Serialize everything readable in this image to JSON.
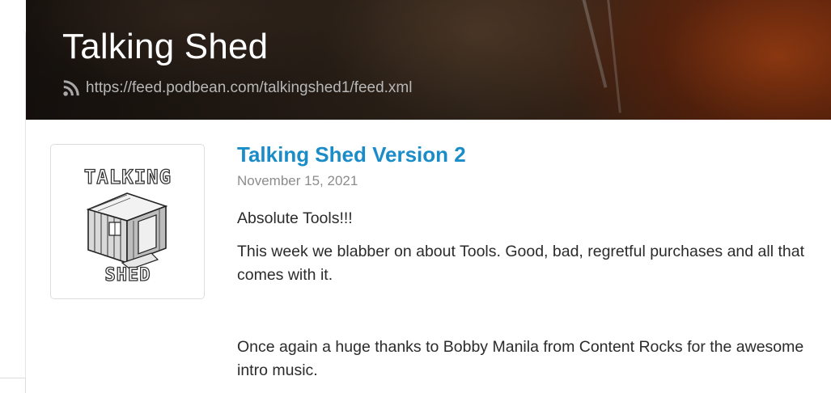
{
  "header": {
    "title": "Talking Shed",
    "feed_url": "https://feed.podbean.com/talkingshed1/feed.xml",
    "rss_icon": "rss-icon"
  },
  "episode": {
    "thumbnail": {
      "icon": "talking-shed-logo",
      "logo_text_top": "TALKING",
      "logo_text_bottom": "SHED"
    },
    "title": "Talking Shed Version 2",
    "date": "November 15, 2021",
    "paragraphs": [
      "Absolute Tools!!!",
      "This week we blabber on about Tools. Good, bad, regretful purchases and all that comes with it.",
      "Once again a huge thanks to Bobby Manila from Content Rocks for the awesome intro music."
    ]
  },
  "colors": {
    "title_link": "#1a8cc8",
    "date": "#8c8c8c",
    "body_text": "#2b2b2b",
    "feed_url": "#b7b7b7"
  }
}
